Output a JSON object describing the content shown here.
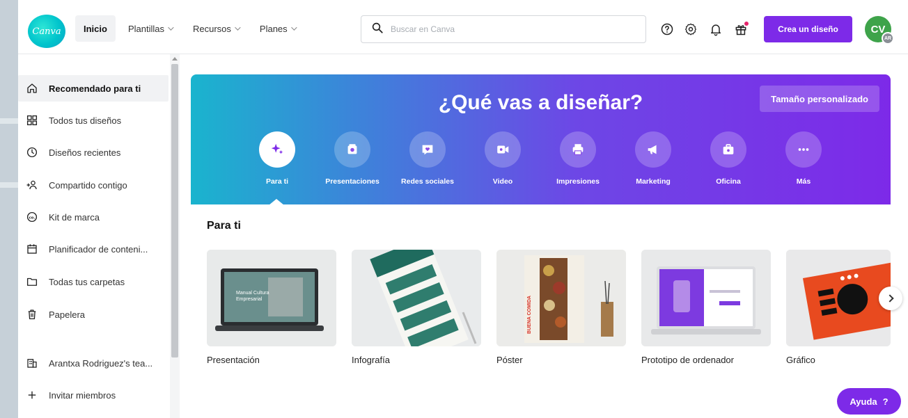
{
  "brand": {
    "logo_text": "Canva",
    "accent": "#7d2ae8",
    "teal": "#00c4cc"
  },
  "nav": {
    "items": [
      {
        "label": "Inicio",
        "active": true,
        "dropdown": false
      },
      {
        "label": "Plantillas",
        "active": false,
        "dropdown": true
      },
      {
        "label": "Recursos",
        "active": false,
        "dropdown": true
      },
      {
        "label": "Planes",
        "active": false,
        "dropdown": true
      }
    ]
  },
  "search": {
    "placeholder": "Buscar en Canva",
    "value": ""
  },
  "header_icons": [
    "help-icon",
    "settings-icon",
    "bell-icon",
    "gift-icon"
  ],
  "create_button": "Crea un diseño",
  "avatar": {
    "initials": "CV",
    "badge": "AR"
  },
  "sidebar": {
    "items": [
      {
        "label": "Recomendado para ti",
        "icon": "home-icon",
        "active": true
      },
      {
        "label": "Todos tus diseños",
        "icon": "grid-icon",
        "active": false
      },
      {
        "label": "Diseños recientes",
        "icon": "clock-icon",
        "active": false
      },
      {
        "label": "Compartido contigo",
        "icon": "shared-users-icon",
        "active": false
      },
      {
        "label": "Kit de marca",
        "icon": "brand-kit-icon",
        "active": false
      },
      {
        "label": "Planificador de conteni...",
        "icon": "calendar-icon",
        "active": false
      },
      {
        "label": "Todas tus carpetas",
        "icon": "folder-icon",
        "active": false
      },
      {
        "label": "Papelera",
        "icon": "trash-icon",
        "active": false
      }
    ],
    "team_label": "Arantxa Rodriguez's tea...",
    "invite_label": "Invitar miembros"
  },
  "hero": {
    "title": "¿Qué vas a diseñar?",
    "custom_size": "Tamaño personalizado",
    "categories": [
      {
        "label": "Para ti",
        "icon": "sparkle-icon",
        "active": true
      },
      {
        "label": "Presentaciones",
        "icon": "presentation-icon",
        "active": false
      },
      {
        "label": "Redes sociales",
        "icon": "heart-chat-icon",
        "active": false
      },
      {
        "label": "Video",
        "icon": "video-icon",
        "active": false
      },
      {
        "label": "Impresiones",
        "icon": "printer-icon",
        "active": false
      },
      {
        "label": "Marketing",
        "icon": "megaphone-icon",
        "active": false
      },
      {
        "label": "Oficina",
        "icon": "briefcase-icon",
        "active": false
      },
      {
        "label": "Más",
        "icon": "more-icon",
        "active": false
      }
    ]
  },
  "section": {
    "title": "Para ti",
    "cards": [
      {
        "label": "Presentación",
        "thumb_text": "Manual Cultura Empresarial"
      },
      {
        "label": "Infografía",
        "thumb_text": ""
      },
      {
        "label": "Póster",
        "thumb_text": "BUENA COMIDA"
      },
      {
        "label": "Prototipo de ordenador",
        "thumb_text": ""
      },
      {
        "label": "Gráfico",
        "thumb_text": ""
      }
    ]
  },
  "help_button": {
    "label": "Ayuda",
    "mark": "?"
  }
}
